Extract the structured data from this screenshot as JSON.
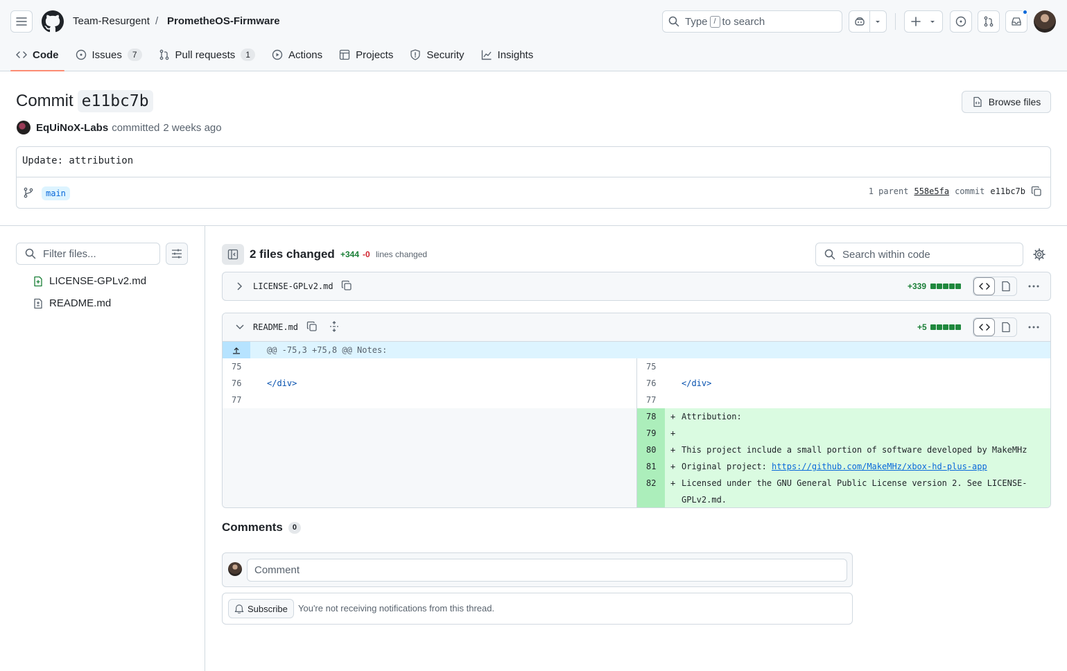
{
  "header": {
    "owner": "Team-Resurgent",
    "separator": "/",
    "repo": "PrometheOS-Firmware",
    "search_prefix": "Type",
    "search_key": "/",
    "search_suffix": "to search"
  },
  "tabs": [
    {
      "label": "Code",
      "icon": "code-icon",
      "active": true
    },
    {
      "label": "Issues",
      "count": "7",
      "icon": "issue-icon"
    },
    {
      "label": "Pull requests",
      "count": "1",
      "icon": "pull-request-icon"
    },
    {
      "label": "Actions",
      "icon": "play-icon"
    },
    {
      "label": "Projects",
      "icon": "table-icon"
    },
    {
      "label": "Security",
      "icon": "shield-icon"
    },
    {
      "label": "Insights",
      "icon": "graph-icon"
    }
  ],
  "commit": {
    "title_prefix": "Commit",
    "sha_short": "e11bc7b",
    "browse_label": "Browse files",
    "author": "EqUiNoX-Labs",
    "action": "committed",
    "time": "2 weeks ago",
    "message": "Update: attribution",
    "branch": "main",
    "parent_label": "1 parent",
    "parent_sha": "558e5fa",
    "commit_label": "commit",
    "commit_sha": "e11bc7b"
  },
  "sidebar": {
    "filter_placeholder": "Filter files...",
    "files": [
      {
        "name": "LICENSE-GPLv2.md",
        "status": "added"
      },
      {
        "name": "README.md",
        "status": "modified"
      }
    ]
  },
  "diff_summary": {
    "files_changed": "2 files changed",
    "additions": "+344",
    "deletions": "-0",
    "lines_label": "lines changed",
    "search_placeholder": "Search within code"
  },
  "files": [
    {
      "name": "LICENSE-GPLv2.md",
      "additions": "+339",
      "collapsed": true
    },
    {
      "name": "README.md",
      "additions": "+5",
      "collapsed": false
    }
  ],
  "diff": {
    "hunk": "@@ -75,3 +75,8 @@ Notes:",
    "context": [
      {
        "left_ln": "75",
        "right_ln": "75",
        "code": ""
      },
      {
        "left_ln": "76",
        "right_ln": "76",
        "code": "</div>"
      },
      {
        "left_ln": "77",
        "right_ln": "77",
        "code": ""
      }
    ],
    "added": [
      {
        "ln": "78",
        "marker": "+",
        "code": "Attribution:"
      },
      {
        "ln": "79",
        "marker": "+",
        "code": ""
      },
      {
        "ln": "80",
        "marker": "+",
        "code": "This project include a small portion of software developed by MakeMHz"
      },
      {
        "ln": "81",
        "marker": "+",
        "code_prefix": "Original project: ",
        "link": "https://github.com/MakeMHz/xbox-hd-plus-app"
      },
      {
        "ln": "82",
        "marker": "+",
        "code": "Licensed under the GNU General Public License version 2. See LICENSE-",
        "code_cont": "GPLv2.md."
      }
    ]
  },
  "comments": {
    "title": "Comments",
    "count": "0",
    "placeholder": "Comment",
    "subscribe_label": "Subscribe",
    "subscribe_text": "You're not receiving notifications from this thread."
  },
  "colors": {
    "accent": "#0969da",
    "add_bg": "#dafbe1",
    "add_ln_bg": "#aceebb",
    "add_text": "#1a7f37",
    "del_text": "#d1242f",
    "tab_underline": "#fd8c73"
  }
}
